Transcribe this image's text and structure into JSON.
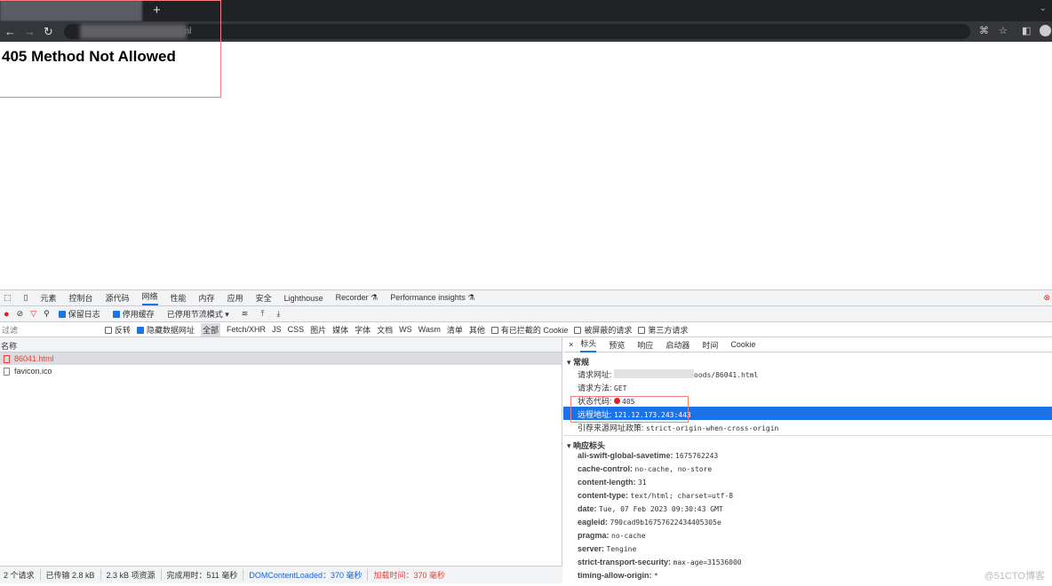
{
  "browser": {
    "new_tab": "+",
    "url_suffix": "tml"
  },
  "page": {
    "heading": "405 Method Not Allowed"
  },
  "devtools": {
    "tabs": [
      "元素",
      "控制台",
      "源代码",
      "网络",
      "性能",
      "内存",
      "应用",
      "安全",
      "Lighthouse",
      "Recorder ⚗",
      "Performance insights ⚗"
    ],
    "active_tab": "网络",
    "toolbar": {
      "preserve_log": "保留日志",
      "disable_cache": "停用缓存",
      "throttle": "已停用节流模式"
    },
    "filter": {
      "placeholder": "过滤",
      "invert": "反转",
      "hide_data_urls": "隐藏数据网址",
      "types": [
        "全部",
        "Fetch/XHR",
        "JS",
        "CSS",
        "图片",
        "媒体",
        "字体",
        "文档",
        "WS",
        "Wasm",
        "清单",
        "其他"
      ],
      "blocked_cookies": "有已拦截的 Cookie",
      "blocked_requests": "被屏蔽的请求",
      "third_party": "第三方请求"
    },
    "requests": {
      "column": "名称",
      "rows": [
        "86041.html",
        "favicon.ico"
      ]
    },
    "status": {
      "count": "2 个请求",
      "transferred": "已传输 2.8 kB",
      "resources": "2.3 kB 项资源",
      "finish": "完成用时：511 毫秒",
      "dcl": "DOMContentLoaded：370 毫秒",
      "load": "加载时间：370 毫秒"
    },
    "detail": {
      "tabs": [
        "标头",
        "预览",
        "响应",
        "启动器",
        "时间",
        "Cookie"
      ],
      "general_title": "常规",
      "general": [
        {
          "k": "请求网址:",
          "v": "oods/86041.html"
        },
        {
          "k": "请求方法:",
          "v": "GET"
        },
        {
          "k": "状态代码:",
          "v": "405"
        },
        {
          "k": "远程地址:",
          "v": "121.12.173.243:443"
        },
        {
          "k": "引荐来源网址政策:",
          "v": "strict-origin-when-cross-origin"
        }
      ],
      "response_title": "响应标头",
      "response": [
        {
          "k": "ali-swift-global-savetime:",
          "v": "1675762243"
        },
        {
          "k": "cache-control:",
          "v": "no-cache, no-store"
        },
        {
          "k": "content-length:",
          "v": "31"
        },
        {
          "k": "content-type:",
          "v": "text/html; charset=utf-8"
        },
        {
          "k": "date:",
          "v": "Tue, 07 Feb 2023 09:30:43 GMT"
        },
        {
          "k": "eagleid:",
          "v": "790cad9b16757622434405305e"
        },
        {
          "k": "pragma:",
          "v": "no-cache"
        },
        {
          "k": "server:",
          "v": "Tengine"
        },
        {
          "k": "strict-transport-security:",
          "v": "max-age=31536000"
        },
        {
          "k": "timing-allow-origin:",
          "v": "*"
        }
      ]
    }
  },
  "watermark": "@51CTO博客",
  "colors": {
    "accent": "#1a73e8",
    "error": "#e8413a"
  }
}
